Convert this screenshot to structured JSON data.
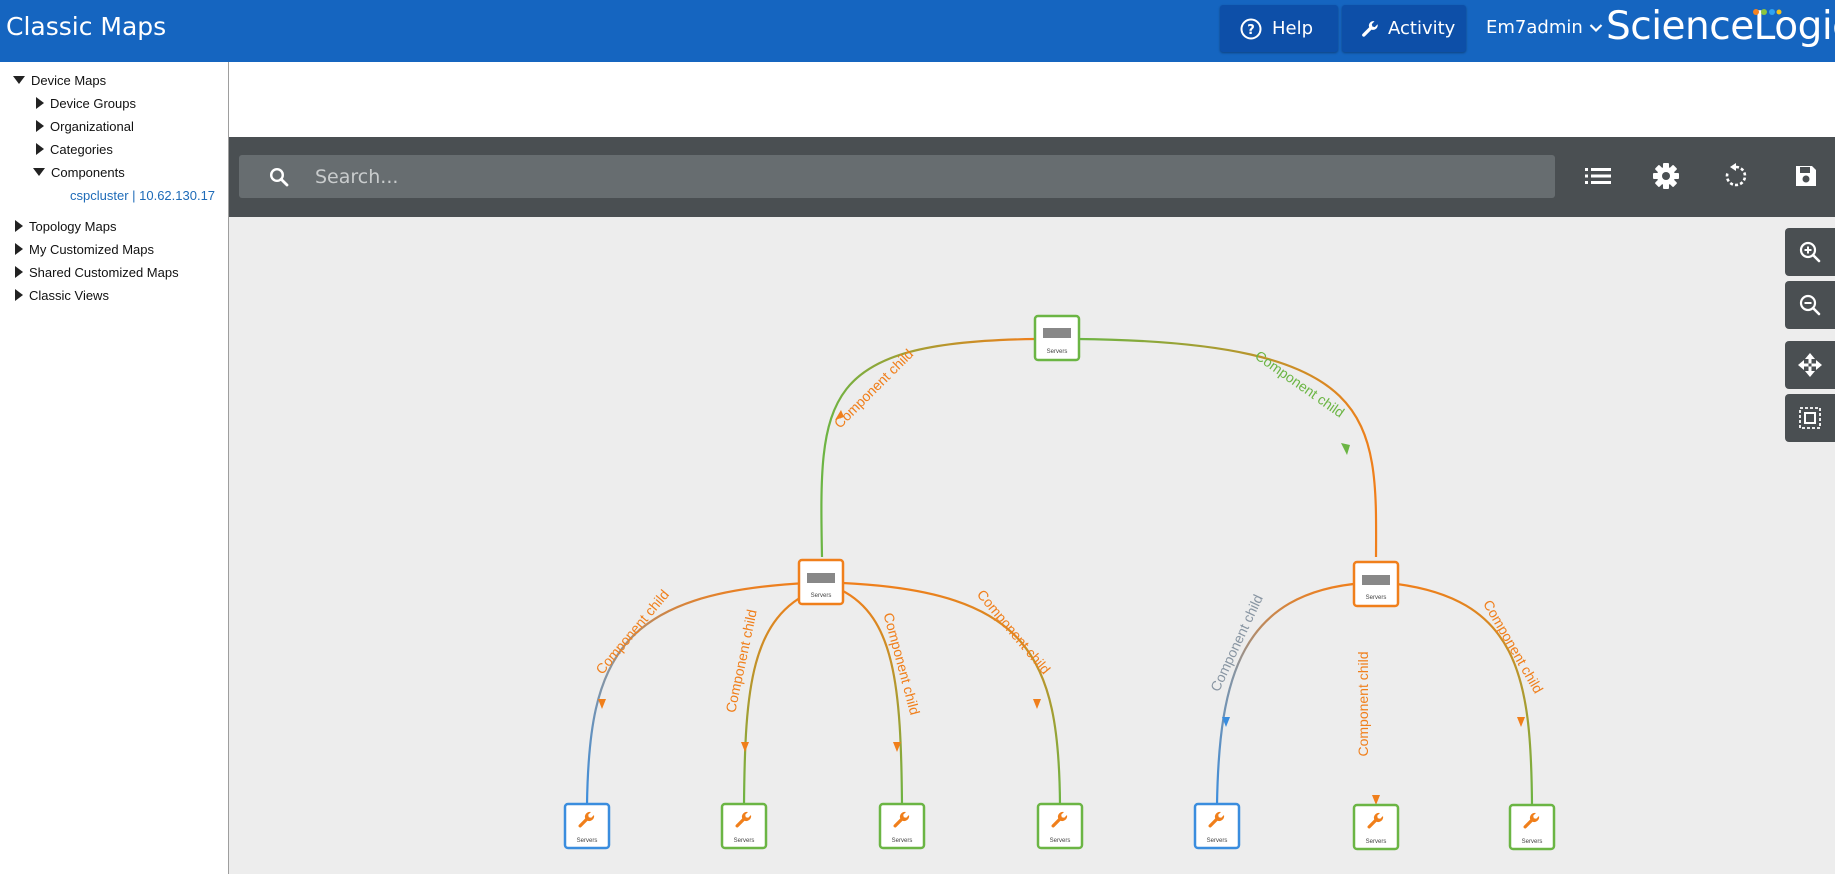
{
  "header": {
    "app_title": "Classic Maps",
    "help_label": "Help",
    "activity_label": "Activity",
    "user_label": "Em7admin",
    "brand": "ScienceLogic",
    "brand_color": "#ffffff",
    "bar_color": "#1565c0"
  },
  "sidebar": {
    "device_maps": "Device Maps",
    "device_groups": "Device Groups",
    "organizational": "Organizational",
    "categories": "Categories",
    "components": "Components",
    "cluster_link": "cspcluster | 10.62.130.17",
    "topology_maps": "Topology Maps",
    "my_customized_maps": "My Customized Maps",
    "shared_customized_maps": "Shared Customized Maps",
    "classic_views": "Classic Views"
  },
  "toolbar": {
    "search_placeholder": "Search...",
    "icons": [
      "list-icon",
      "gear-icon",
      "refresh-icon",
      "save-icon"
    ]
  },
  "map_controls": [
    "zoom-in-icon",
    "zoom-out-icon",
    "pan-icon",
    "fit-icon"
  ],
  "map": {
    "edge_label": "Component child",
    "node_caption": "Servers",
    "colors": {
      "orange": "#f07f1b",
      "green": "#6bb544",
      "blue": "#3a8dde",
      "grey": "#8895a2"
    }
  }
}
